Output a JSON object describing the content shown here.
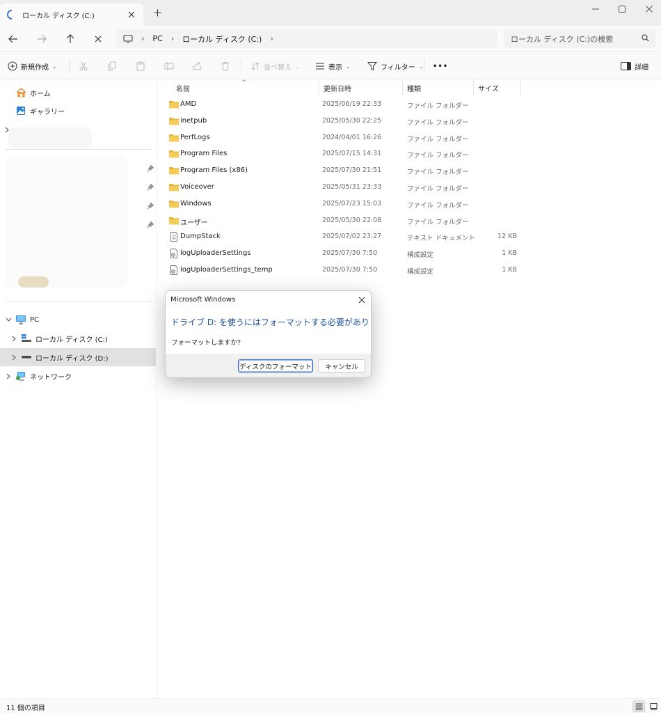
{
  "window": {
    "tab_title": "ローカル ディスク (C:)",
    "new_tab": "+"
  },
  "address": {
    "crumbs": [
      "PC",
      "ローカル ディスク (C:)"
    ],
    "search_placeholder": "ローカル ディスク (C:)の検索"
  },
  "commands": {
    "new": "新規作成",
    "sort": "並べ替え",
    "view": "表示",
    "filter": "フィルター",
    "more": "•••",
    "details": "詳細"
  },
  "sidebar": {
    "home": "ホーム",
    "gallery": "ギャラリー",
    "pc": "PC",
    "drive_c": "ローカル ディスク (C:)",
    "drive_d": "ローカル ディスク (D:)",
    "network": "ネットワーク"
  },
  "columns": {
    "name": "名前",
    "date": "更新日時",
    "type": "種類",
    "size": "サイズ"
  },
  "files": [
    {
      "name": "AMD",
      "date": "2025/06/19 22:33",
      "type": "ファイル フォルダー",
      "size": "",
      "icon": "folder-icon"
    },
    {
      "name": "inetpub",
      "date": "2025/05/30 22:25",
      "type": "ファイル フォルダー",
      "size": "",
      "icon": "folder-icon"
    },
    {
      "name": "PerfLogs",
      "date": "2024/04/01 16:26",
      "type": "ファイル フォルダー",
      "size": "",
      "icon": "folder-icon"
    },
    {
      "name": "Program Files",
      "date": "2025/07/15 14:31",
      "type": "ファイル フォルダー",
      "size": "",
      "icon": "folder-icon"
    },
    {
      "name": "Program Files (x86)",
      "date": "2025/07/30 21:51",
      "type": "ファイル フォルダー",
      "size": "",
      "icon": "folder-icon"
    },
    {
      "name": "Voiceover",
      "date": "2025/05/31 23:33",
      "type": "ファイル フォルダー",
      "size": "",
      "icon": "folder-icon"
    },
    {
      "name": "Windows",
      "date": "2025/07/23 15:03",
      "type": "ファイル フォルダー",
      "size": "",
      "icon": "folder-icon"
    },
    {
      "name": "ユーザー",
      "date": "2025/05/30 22:08",
      "type": "ファイル フォルダー",
      "size": "",
      "icon": "folder-icon"
    },
    {
      "name": "DumpStack",
      "date": "2025/07/02 23:27",
      "type": "テキスト ドキュメント",
      "size": "12 KB",
      "icon": "text-file-icon"
    },
    {
      "name": "logUploaderSettings",
      "date": "2025/07/30 7:50",
      "type": "構成設定",
      "size": "1 KB",
      "icon": "settings-file-icon"
    },
    {
      "name": "logUploaderSettings_temp",
      "date": "2025/07/30 7:50",
      "type": "構成設定",
      "size": "1 KB",
      "icon": "settings-file-icon"
    }
  ],
  "status": {
    "item_count": "11 個の項目"
  },
  "dialog": {
    "title": "Microsoft Windows",
    "heading": "ドライブ D: を使うにはフォーマットする必要があります。",
    "message": "フォーマットしますか?",
    "format_button": "ディスクのフォーマット",
    "cancel_button": "キャンセル"
  },
  "colors": {
    "accent": "#1c4f9c",
    "folder": "#f2c046",
    "selected_nav": "#e1e1e1"
  }
}
